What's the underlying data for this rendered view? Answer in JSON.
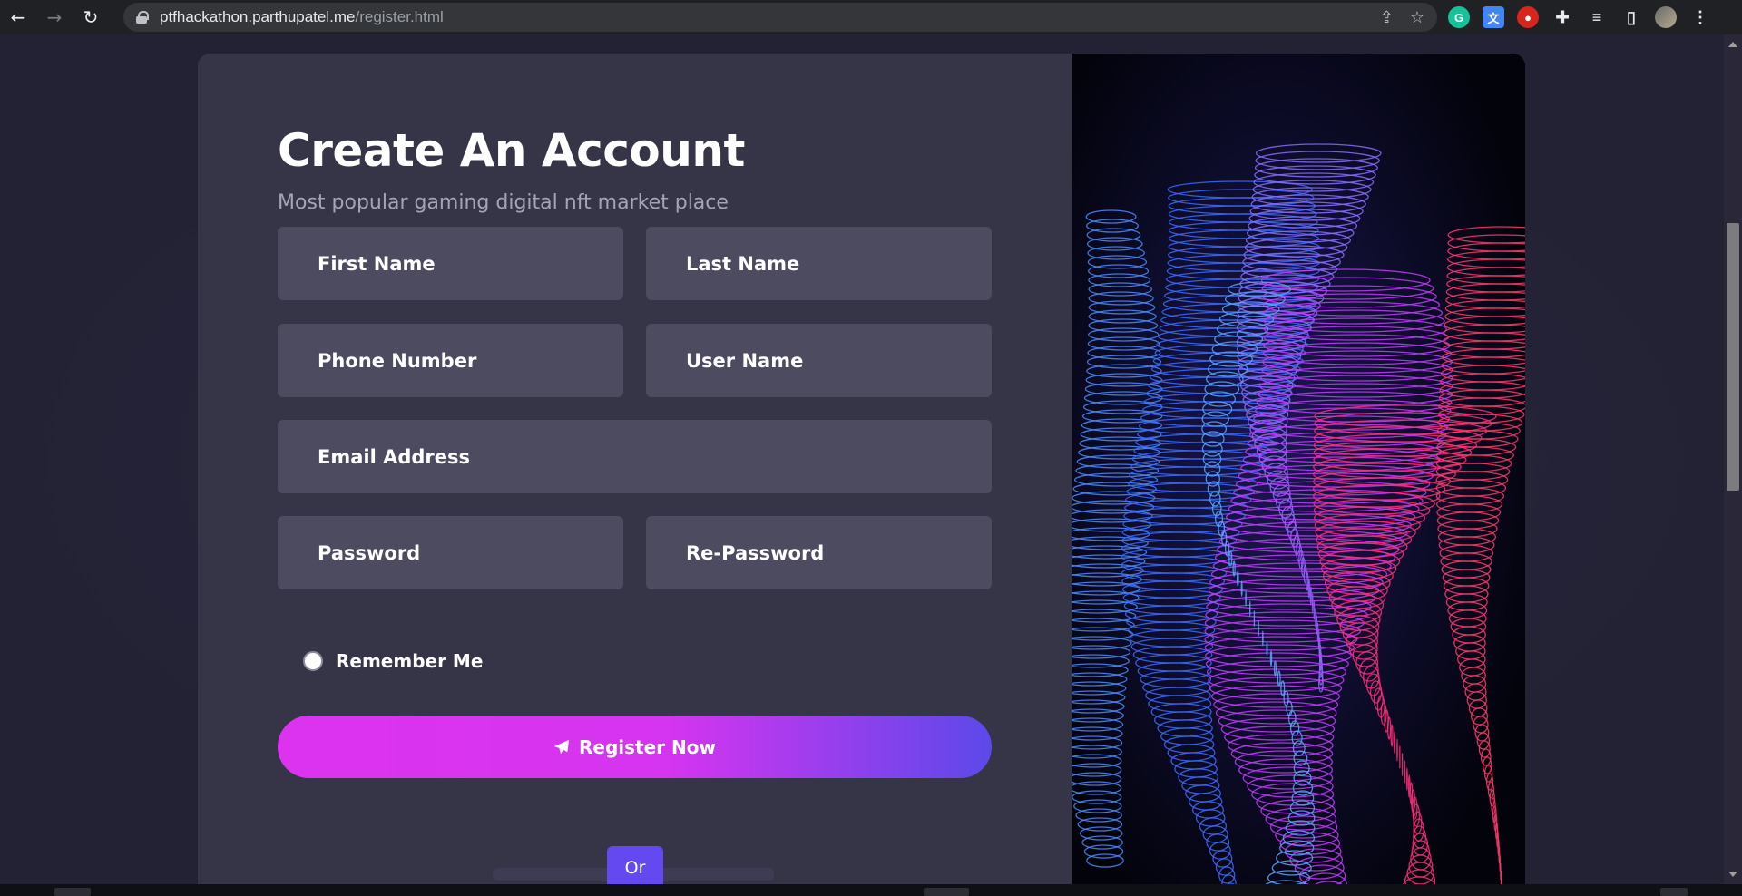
{
  "browser": {
    "url_host": "ptfhackathon.parthupatel.me",
    "url_path": "/register.html",
    "nav_icons": [
      "back-icon",
      "forward-icon",
      "reload-icon"
    ],
    "omnibox_icons": [
      "share-icon",
      "bookmark-star-icon"
    ],
    "extensions": [
      {
        "name": "grammarly-extension",
        "glyph": "G"
      },
      {
        "name": "translate-extension",
        "glyph": "文"
      },
      {
        "name": "red-extension",
        "glyph": "●"
      },
      {
        "name": "extensions-puzzle-icon",
        "glyph": "✚"
      },
      {
        "name": "media-queue-icon",
        "glyph": "≡"
      },
      {
        "name": "side-panel-icon",
        "glyph": "▯"
      },
      {
        "name": "profile-avatar",
        "glyph": ""
      },
      {
        "name": "menu-kebab-icon",
        "glyph": "⋮"
      }
    ]
  },
  "form": {
    "title": "Create An Account",
    "subtitle": "Most popular gaming digital nft market place",
    "first_name": "First Name",
    "last_name": "Last Name",
    "phone_number": "Phone Number",
    "user_name": "User Name",
    "email": "Email Address",
    "password": "Password",
    "re_password": "Re-Password",
    "remember_me": "Remember Me",
    "register_label": "Register Now",
    "or_label": "Or"
  },
  "colors": {
    "page_bg": "#232134",
    "card_bg": "#363447",
    "field_bg": "#4d4b60",
    "button_gradient_start": "#dd33f0",
    "button_gradient_end": "#5c49ea",
    "or_button": "#6448f0"
  }
}
